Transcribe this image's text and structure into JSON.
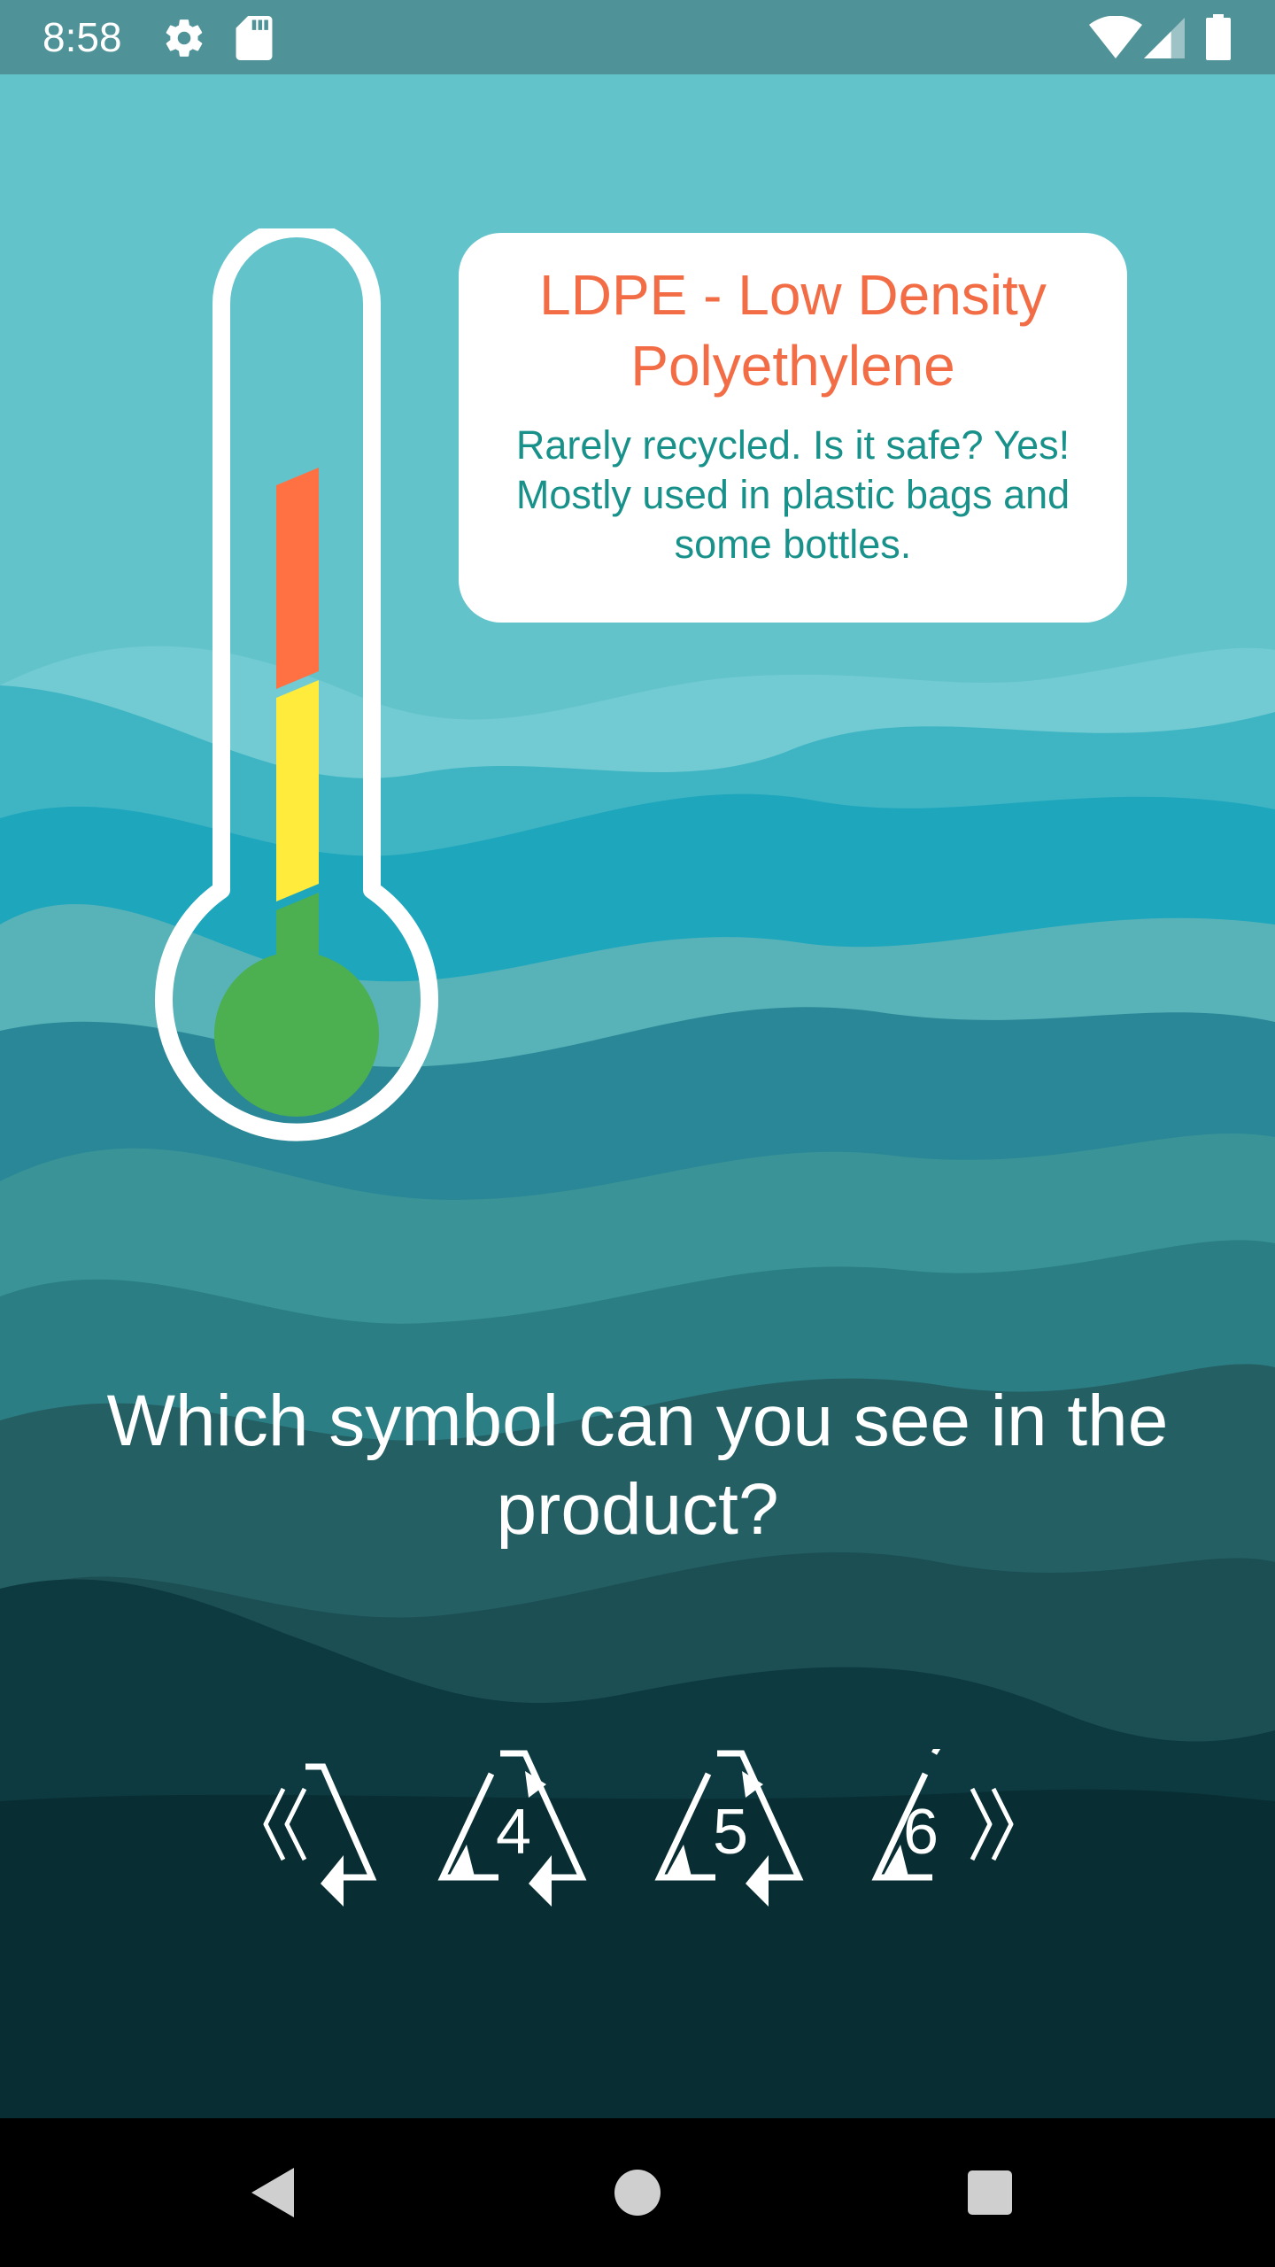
{
  "status_bar": {
    "time": "8:58",
    "icons_left": [
      "gear-icon",
      "sd-card-icon"
    ],
    "icons_right": [
      "wifi-icon",
      "signal-icon",
      "battery-icon"
    ]
  },
  "thermometer": {
    "levels": [
      "green",
      "yellow",
      "orange"
    ],
    "colors": {
      "green": "#4caf50",
      "yellow": "#ffeb3b",
      "orange": "#ff7043"
    }
  },
  "info_card": {
    "title": "LDPE - Low Density Polyethylene",
    "description": "Rarely recycled. Is it safe? Yes! Mostly used in plastic bags and some bottles."
  },
  "question": "Which symbol can you see in the product?",
  "carousel": {
    "symbols": [
      "",
      "4",
      "5",
      "6"
    ],
    "prev_icon": "chevron-double-left-icon",
    "next_icon": "chevron-double-right-icon"
  },
  "nav_bar": {
    "icons": [
      "back-icon",
      "home-icon",
      "recents-icon"
    ]
  },
  "colors": {
    "status_bar": "#4f9398",
    "title_orange": "#f26d45",
    "desc_teal": "#17918a",
    "nav_bar": "#000000"
  }
}
